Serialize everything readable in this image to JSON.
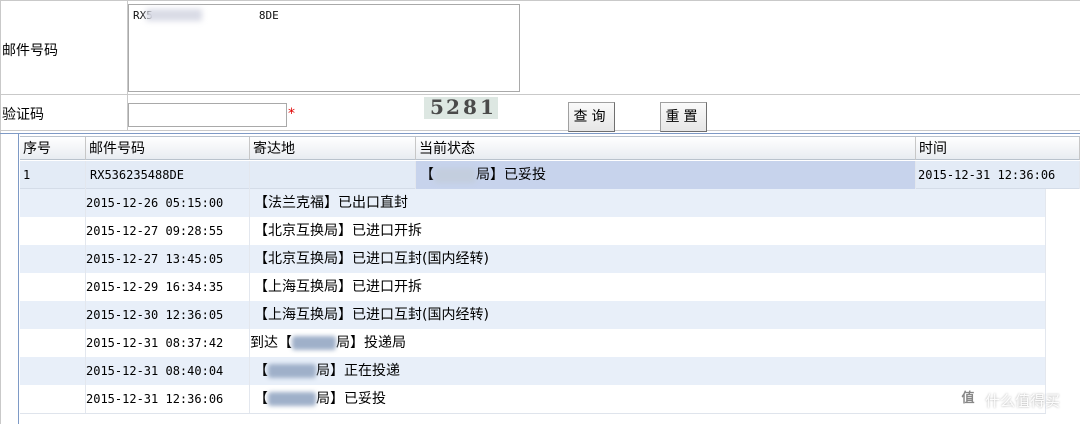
{
  "form": {
    "mail_label": "邮件号码",
    "mail_value": "RX5                8DE",
    "verify_label": "验证码",
    "verify_value": "",
    "required_mark": "*",
    "captcha_text": [
      "5",
      "2",
      "8",
      "1"
    ],
    "query_button": "查询",
    "reset_button": "重置"
  },
  "grid": {
    "headers": [
      "序号",
      "邮件号码",
      "寄达地",
      "当前状态",
      "时间"
    ],
    "summary": {
      "index": "1",
      "mail_no": "RX536235488DE",
      "destination": "",
      "status_prefix": "【",
      "status_suffix": "局】已妥投",
      "time": "2015-12-31  12:36:06"
    },
    "details": [
      {
        "time": "2015-12-26 05:15:00",
        "event": "【法兰克福】已出口直封"
      },
      {
        "time": "2015-12-27 09:28:55",
        "event": "【北京互换局】已进口开拆"
      },
      {
        "time": "2015-12-27 13:45:05",
        "event": "【北京互换局】已进口互封(国内经转)"
      },
      {
        "time": "2015-12-29 16:34:35",
        "event": "【上海互换局】已进口开拆"
      },
      {
        "time": "2015-12-30 12:36:05",
        "event": "【上海互换局】已进口互封(国内经转)"
      },
      {
        "time": "2015-12-31 08:37:42",
        "event_prefix": "到达【",
        "event_suffix": "局】投递局"
      },
      {
        "time": "2015-12-31 08:40:04",
        "event_prefix": "【",
        "event_suffix": "局】正在投递"
      },
      {
        "time": "2015-12-31 12:36:06",
        "event_prefix": "【",
        "event_suffix": "局】已妥投"
      }
    ]
  },
  "watermark": {
    "icon_text": "值",
    "text": "什么值得买"
  },
  "colors": {
    "row_alt": "#e8eff9",
    "row_plain": "#ffffff",
    "summary_status_bg": "#c7d3ec",
    "summary_row_bg": "#e3ebf6",
    "required": "#e00000"
  }
}
